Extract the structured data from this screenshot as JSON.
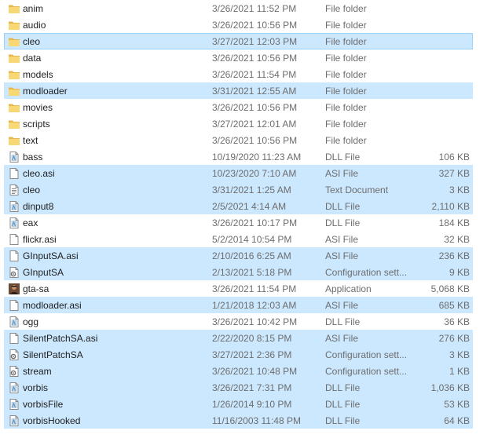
{
  "rows": [
    {
      "name": "anim",
      "date": "3/26/2021 11:52 PM",
      "type": "File folder",
      "size": "",
      "icon": "folder-icon",
      "selected": false
    },
    {
      "name": "audio",
      "date": "3/26/2021 10:56 PM",
      "type": "File folder",
      "size": "",
      "icon": "folder-icon",
      "selected": false
    },
    {
      "name": "cleo",
      "date": "3/27/2021 12:03 PM",
      "type": "File folder",
      "size": "",
      "icon": "folder-icon",
      "selected": true,
      "focused": true
    },
    {
      "name": "data",
      "date": "3/26/2021 10:56 PM",
      "type": "File folder",
      "size": "",
      "icon": "folder-icon",
      "selected": false
    },
    {
      "name": "models",
      "date": "3/26/2021 11:54 PM",
      "type": "File folder",
      "size": "",
      "icon": "folder-icon",
      "selected": false
    },
    {
      "name": "modloader",
      "date": "3/31/2021 12:55 AM",
      "type": "File folder",
      "size": "",
      "icon": "folder-icon",
      "selected": true
    },
    {
      "name": "movies",
      "date": "3/26/2021 10:56 PM",
      "type": "File folder",
      "size": "",
      "icon": "folder-icon",
      "selected": false
    },
    {
      "name": "scripts",
      "date": "3/27/2021 12:01 AM",
      "type": "File folder",
      "size": "",
      "icon": "folder-icon",
      "selected": false
    },
    {
      "name": "text",
      "date": "3/26/2021 10:56 PM",
      "type": "File folder",
      "size": "",
      "icon": "folder-icon",
      "selected": false
    },
    {
      "name": "bass",
      "date": "10/19/2020 11:23 AM",
      "type": "DLL File",
      "size": "106 KB",
      "icon": "dll-file-icon",
      "selected": false
    },
    {
      "name": "cleo.asi",
      "date": "10/23/2020 7:10 AM",
      "type": "ASI File",
      "size": "327 KB",
      "icon": "blank-file-icon",
      "selected": true
    },
    {
      "name": "cleo",
      "date": "3/31/2021 1:25 AM",
      "type": "Text Document",
      "size": "3 KB",
      "icon": "text-file-icon",
      "selected": true
    },
    {
      "name": "dinput8",
      "date": "2/5/2021 4:14 AM",
      "type": "DLL File",
      "size": "2,110 KB",
      "icon": "dll-file-icon",
      "selected": true
    },
    {
      "name": "eax",
      "date": "3/26/2021 10:17 PM",
      "type": "DLL File",
      "size": "184 KB",
      "icon": "dll-file-icon",
      "selected": false
    },
    {
      "name": "flickr.asi",
      "date": "5/2/2014 10:54 PM",
      "type": "ASI File",
      "size": "32 KB",
      "icon": "blank-file-icon",
      "selected": false
    },
    {
      "name": "GInputSA.asi",
      "date": "2/10/2016 6:25 AM",
      "type": "ASI File",
      "size": "236 KB",
      "icon": "blank-file-icon",
      "selected": true
    },
    {
      "name": "GInputSA",
      "date": "2/13/2021 5:18 PM",
      "type": "Configuration sett...",
      "size": "9 KB",
      "icon": "config-file-icon",
      "selected": true
    },
    {
      "name": "gta-sa",
      "date": "3/26/2021 11:54 PM",
      "type": "Application",
      "size": "5,068 KB",
      "icon": "app-icon",
      "selected": false
    },
    {
      "name": "modloader.asi",
      "date": "1/21/2018 12:03 AM",
      "type": "ASI File",
      "size": "685 KB",
      "icon": "blank-file-icon",
      "selected": true
    },
    {
      "name": "ogg",
      "date": "3/26/2021 10:42 PM",
      "type": "DLL File",
      "size": "36 KB",
      "icon": "dll-file-icon",
      "selected": false
    },
    {
      "name": "SilentPatchSA.asi",
      "date": "2/22/2020 8:15 PM",
      "type": "ASI File",
      "size": "276 KB",
      "icon": "blank-file-icon",
      "selected": true
    },
    {
      "name": "SilentPatchSA",
      "date": "3/27/2021 2:36 PM",
      "type": "Configuration sett...",
      "size": "3 KB",
      "icon": "config-file-icon",
      "selected": true
    },
    {
      "name": "stream",
      "date": "3/26/2021 10:48 PM",
      "type": "Configuration sett...",
      "size": "1 KB",
      "icon": "config-file-icon",
      "selected": true
    },
    {
      "name": "vorbis",
      "date": "3/26/2021 7:31 PM",
      "type": "DLL File",
      "size": "1,036 KB",
      "icon": "dll-file-icon",
      "selected": true
    },
    {
      "name": "vorbisFile",
      "date": "1/26/2014 9:10 PM",
      "type": "DLL File",
      "size": "53 KB",
      "icon": "dll-file-icon",
      "selected": true
    },
    {
      "name": "vorbisHooked",
      "date": "11/16/2003 11:48 PM",
      "type": "DLL File",
      "size": "64 KB",
      "icon": "dll-file-icon",
      "selected": true
    }
  ],
  "colors": {
    "selection_bg": "#cce8ff",
    "focus_border": "#99d1ff",
    "folder": "#f8d775",
    "secondary_text": "#6d6d6d"
  }
}
